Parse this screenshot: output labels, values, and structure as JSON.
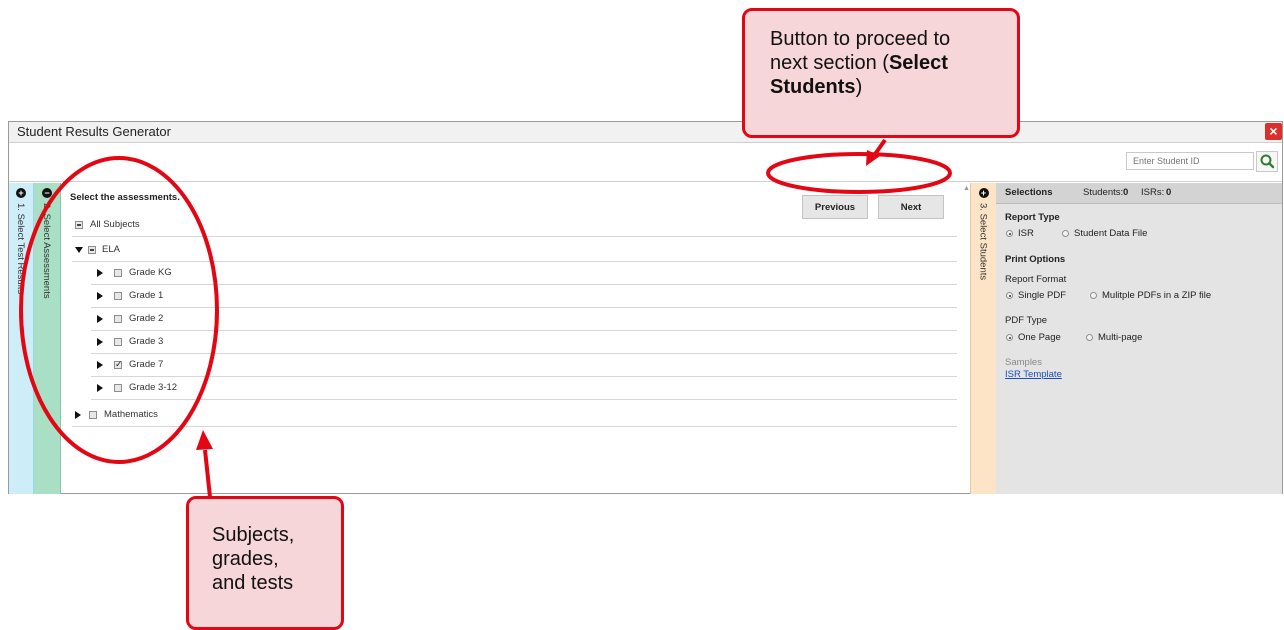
{
  "window": {
    "title": "Student Results Generator",
    "close_label": "×",
    "search": {
      "placeholder": "Enter Student ID"
    }
  },
  "steps": [
    {
      "number": "1.",
      "label": "Select Test Results",
      "icon": "plus-circle-icon"
    },
    {
      "number": "2.",
      "label": "Select Assessments",
      "icon": "minus-circle-icon"
    },
    {
      "number": "3.",
      "label": "Select Students",
      "icon": "plus-circle-icon"
    }
  ],
  "assessments": {
    "heading": "Select the assessments.",
    "previous_label": "Previous",
    "next_label": "Next",
    "all_subjects": "All Subjects",
    "subjects": [
      {
        "label": "ELA",
        "grades": [
          {
            "label": "Grade KG",
            "checked": false
          },
          {
            "label": "Grade 1",
            "checked": false
          },
          {
            "label": "Grade 2",
            "checked": false
          },
          {
            "label": "Grade 3",
            "checked": false
          },
          {
            "label": "Grade 7",
            "checked": true
          },
          {
            "label": "Grade 3-12",
            "checked": false
          }
        ]
      },
      {
        "label": "Mathematics"
      }
    ]
  },
  "selections": {
    "title": "Selections",
    "students_label": "Students:",
    "students_count": "0",
    "isrs_label": "ISRs:",
    "isrs_count": "0",
    "report_type_heading": "Report Type",
    "report_type_options": [
      "ISR",
      "Student Data File"
    ],
    "print_options_heading": "Print Options",
    "report_format_label": "Report Format",
    "report_format_options": [
      "Single PDF",
      "Mulitple PDFs in a ZIP file"
    ],
    "pdf_type_label": "PDF Type",
    "pdf_type_options": [
      "One Page",
      "Multi-page"
    ],
    "samples_label": "Samples",
    "isr_template_link": "ISR Template"
  },
  "annotations": {
    "top_callout_line1": "Button to proceed to",
    "top_callout_line2": "next section (",
    "top_callout_bold1": "Select",
    "top_callout_bold2": "Students",
    "top_callout_end": ")",
    "bottom_callout_line1": "Subjects,",
    "bottom_callout_line2": "grades,",
    "bottom_callout_line3": "and tests",
    "color": "#e30613"
  }
}
